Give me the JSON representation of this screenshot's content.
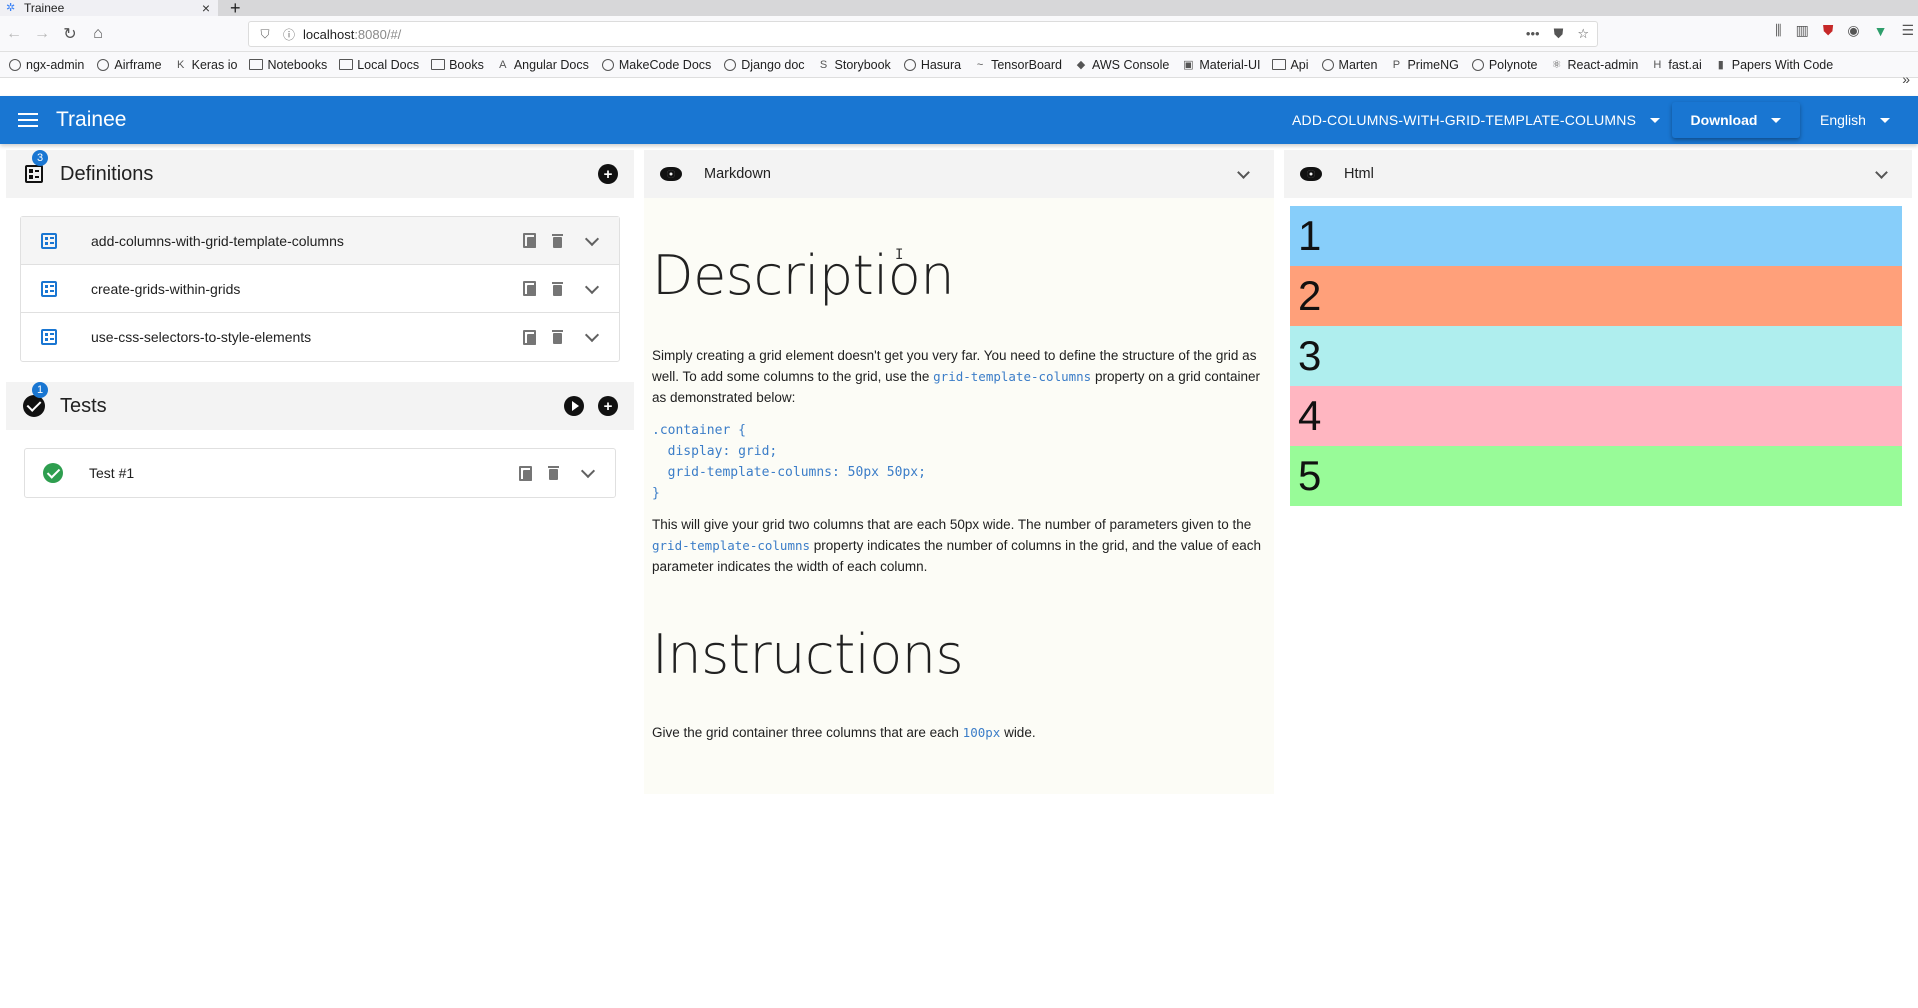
{
  "browser": {
    "tab_title": "Trainee",
    "new_tab": "+",
    "url_host": "localhost",
    "url_rest": ":8080/#/",
    "bookmarks": [
      {
        "label": "ngx-admin",
        "icon": "globe"
      },
      {
        "label": "Airframe",
        "icon": "globe"
      },
      {
        "label": "Keras io",
        "icon": "keras"
      },
      {
        "label": "Notebooks",
        "icon": "folder"
      },
      {
        "label": "Local Docs",
        "icon": "folder"
      },
      {
        "label": "Books",
        "icon": "folder"
      },
      {
        "label": "Angular Docs",
        "icon": "angular"
      },
      {
        "label": "MakeCode Docs",
        "icon": "globe"
      },
      {
        "label": "Django doc",
        "icon": "globe"
      },
      {
        "label": "Storybook",
        "icon": "storybook"
      },
      {
        "label": "Hasura",
        "icon": "globe"
      },
      {
        "label": "TensorBoard",
        "icon": "tensorboard"
      },
      {
        "label": "AWS Console",
        "icon": "aws"
      },
      {
        "label": "Material-UI",
        "icon": "material"
      },
      {
        "label": "Api",
        "icon": "folder"
      },
      {
        "label": "Marten",
        "icon": "globe"
      },
      {
        "label": "PrimeNG",
        "icon": "primeng"
      },
      {
        "label": "Polynote",
        "icon": "globe"
      },
      {
        "label": "React-admin",
        "icon": "react"
      },
      {
        "label": "fast.ai",
        "icon": "fastai"
      },
      {
        "label": "Papers With Code",
        "icon": "pwc"
      }
    ]
  },
  "appbar": {
    "title": "Trainee",
    "definition_select": "ADD-COLUMNS-WITH-GRID-TEMPLATE-COLUMNS",
    "download_label": "Download",
    "language": "English",
    "color": "#1976d2"
  },
  "definitions": {
    "title": "Definitions",
    "badge": "3",
    "items": [
      {
        "label": "add-columns-with-grid-template-columns",
        "selected": true
      },
      {
        "label": "create-grids-within-grids",
        "selected": false
      },
      {
        "label": "use-css-selectors-to-style-elements",
        "selected": false
      }
    ]
  },
  "tests": {
    "title": "Tests",
    "badge": "1",
    "items": [
      {
        "label": "Test #1",
        "status": "passed"
      }
    ]
  },
  "markdown_panel": {
    "title": "Markdown",
    "h1_description": "Description",
    "p1_a": "Simply creating a grid element doesn't get you very far. You need to define the structure of the grid as well. To add some columns to the grid, use the ",
    "p1_code": "grid-template-columns",
    "p1_b": " property on a grid container as demonstrated below:",
    "code_block": ".container {\n  display: grid;\n  grid-template-columns: 50px 50px;\n}",
    "p2_a": "This will give your grid two columns that are each 50px wide. The number of parameters given to the ",
    "p2_code": "grid-template-columns",
    "p2_b": " property indicates the number of columns in the grid, and the value of each parameter indicates the width of each column.",
    "h1_instructions": "Instructions",
    "p3_a": "Give the grid container three columns that are each ",
    "p3_code": "100px",
    "p3_b": " wide."
  },
  "html_panel": {
    "title": "Html",
    "cells": [
      {
        "label": "1",
        "color": "#87cefa"
      },
      {
        "label": "2",
        "color": "#ffa07a"
      },
      {
        "label": "3",
        "color": "#afeeee"
      },
      {
        "label": "4",
        "color": "#ffb6c1"
      },
      {
        "label": "5",
        "color": "#98fb98"
      }
    ]
  }
}
